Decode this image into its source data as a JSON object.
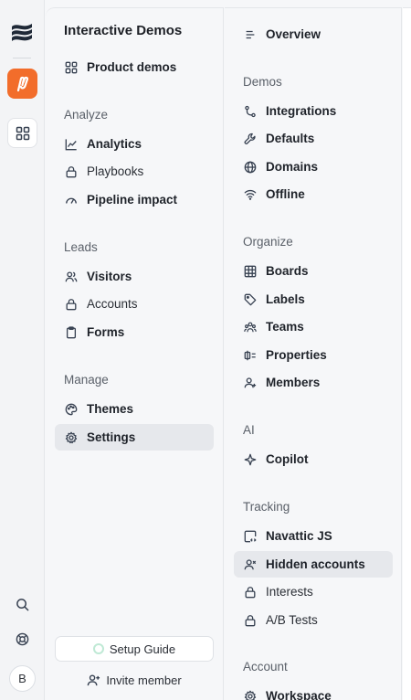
{
  "workspace": {
    "title": "Interactive Demos",
    "product_demos": "Product demos",
    "analyze_label": "Analyze",
    "analyze_items": [
      "Analytics",
      "Playbooks",
      "Pipeline impact"
    ],
    "leads_label": "Leads",
    "leads_items": [
      "Visitors",
      "Accounts",
      "Forms"
    ],
    "manage_label": "Manage",
    "manage_items": [
      "Themes",
      "Settings"
    ],
    "setup_guide": "Setup Guide",
    "invite_member": "Invite member"
  },
  "rail": {
    "avatar_initial": "B",
    "accent_color": "#f26d2b"
  },
  "settings": {
    "overview": "Overview",
    "demos_label": "Demos",
    "demos_items": [
      "Integrations",
      "Defaults",
      "Domains",
      "Offline"
    ],
    "organize_label": "Organize",
    "organize_items": [
      "Boards",
      "Labels",
      "Teams",
      "Properties",
      "Members"
    ],
    "ai_label": "AI",
    "ai_items": [
      "Copilot"
    ],
    "tracking_label": "Tracking",
    "tracking_items": [
      "Navattic JS",
      "Hidden accounts",
      "Interests",
      "A/B Tests"
    ],
    "account_label": "Account",
    "account_items": [
      "Workspace"
    ]
  },
  "icons": {
    "rail": [
      "brand-logo-icon",
      "app-icon",
      "grid-icon",
      "search-icon",
      "help-icon"
    ],
    "active_items": [
      "Settings",
      "Hidden accounts"
    ]
  }
}
